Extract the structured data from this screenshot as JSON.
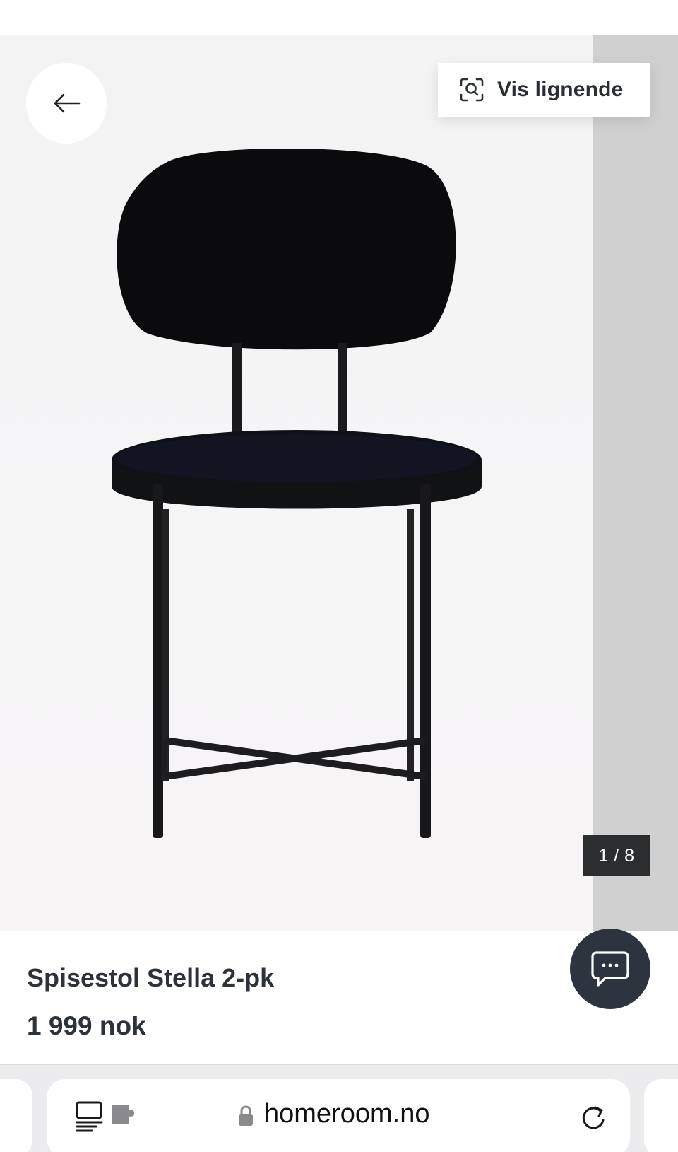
{
  "gallery": {
    "back_label": "",
    "similar_label": "Vis lignende",
    "counter": "1 / 8"
  },
  "product": {
    "title": "Spisestol Stella 2-pk",
    "price": "1 999 nok"
  },
  "browser": {
    "url": "homeroom.no"
  },
  "icons": {
    "back": "arrow-left-icon",
    "similar": "visual-search-icon",
    "chat": "chat-bubble-icon",
    "reader": "reader-mode-icon",
    "extension": "extension-icon",
    "lock": "lock-icon",
    "reload": "reload-icon"
  },
  "colors": {
    "text_dark": "#2d323a",
    "chat_bg": "#2d3440",
    "counter_bg": "#2b2d2f",
    "next_slide": "#d0d0d0"
  }
}
